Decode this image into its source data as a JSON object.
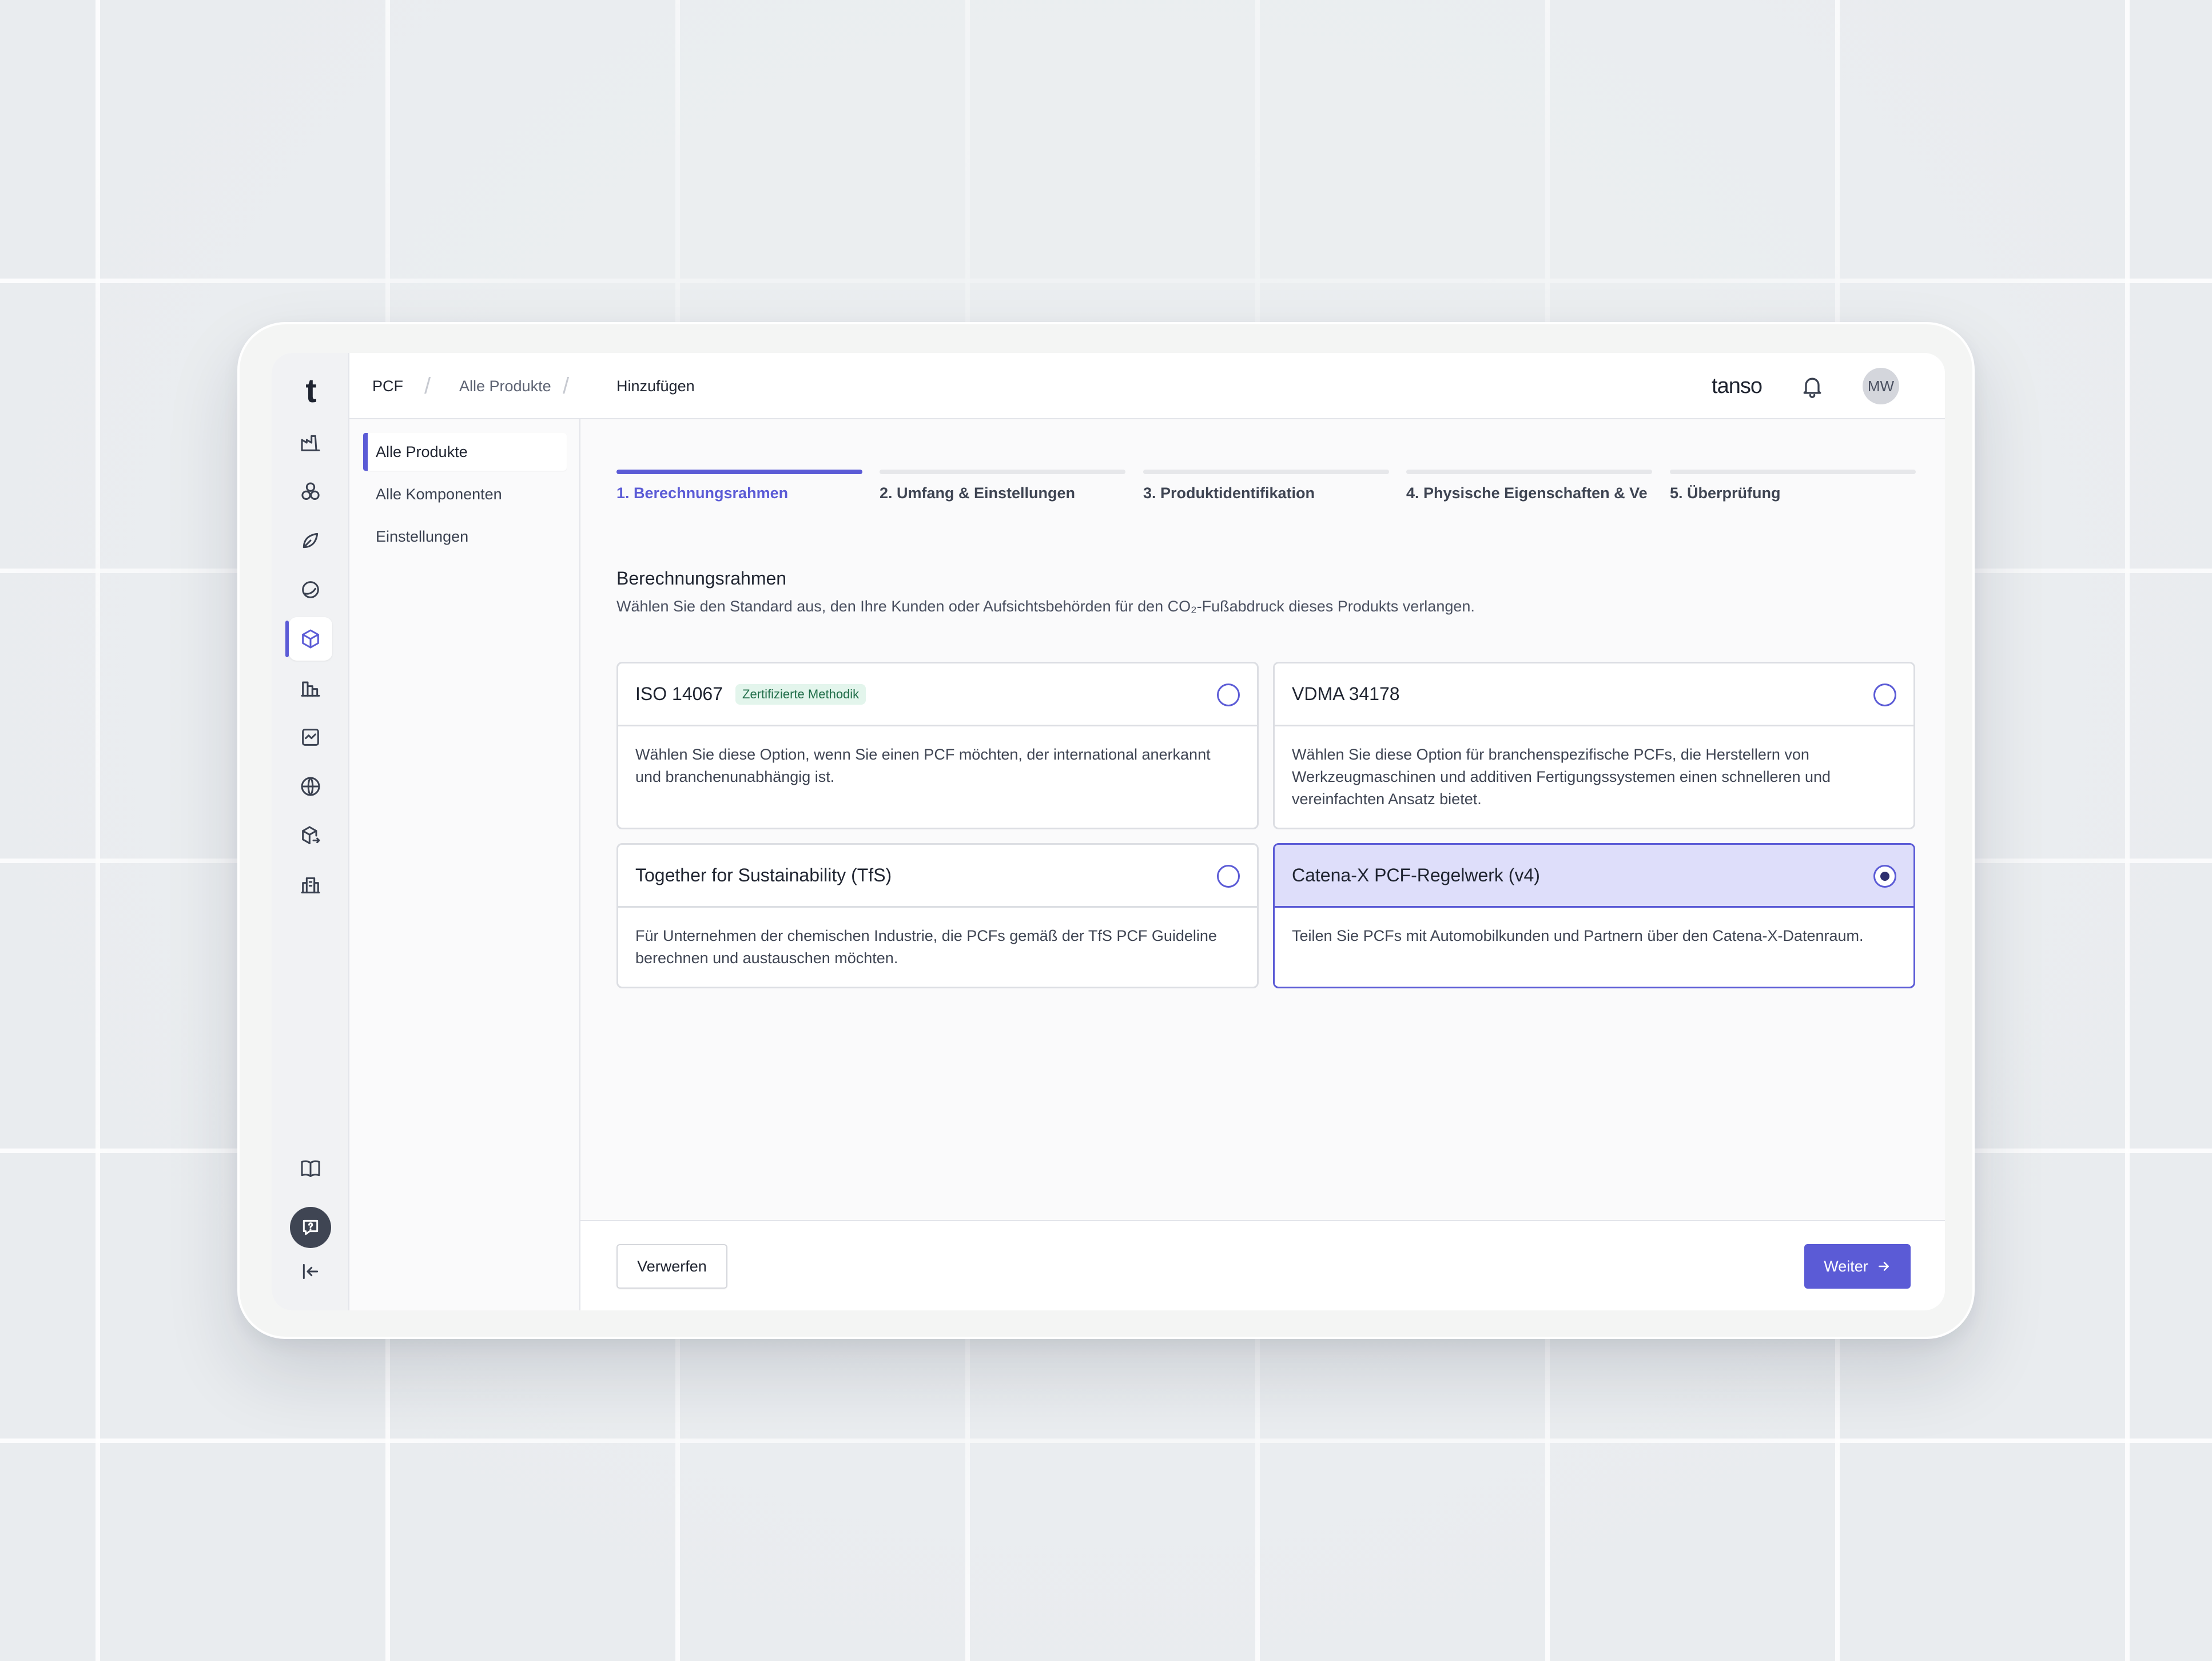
{
  "app": {
    "logo": "t",
    "brand": "tanso",
    "user_initials": "MW"
  },
  "breadcrumb": [
    "PCF",
    "Alle Produkte",
    "Hinzufügen"
  ],
  "rail": {
    "top_icons": [
      "factory-icon",
      "components-icon",
      "leaf-icon",
      "circular-icon",
      "product-box-icon",
      "bar-chart-icon",
      "report-icon",
      "globe-icon",
      "box-transfer-icon",
      "buildings-icon"
    ],
    "active_icon": "product-box-icon",
    "bottom_icons": [
      "book-icon",
      "help-chat-icon",
      "collapse-sidebar-icon"
    ]
  },
  "subnav": {
    "items": [
      "Alle Produkte",
      "Alle Komponenten",
      "Einstellungen"
    ],
    "active": "Alle Produkte"
  },
  "steps": [
    "1. Berechnungsrahmen",
    "2. Umfang & Einstellungen",
    "3. Produktidentifikation",
    "4. Physische Eigenschaften & Ve",
    "5. Überprüfung"
  ],
  "active_step": 1,
  "section": {
    "title": "Berechnungsrahmen",
    "description": "Wählen Sie den Standard aus, den Ihre Kunden oder Aufsichtsbehörden für den CO₂-Fußabdruck dieses Produkts verlangen."
  },
  "options": [
    {
      "title": "ISO 14067",
      "badge": "Zertifizierte Methodik",
      "description": "Wählen Sie diese Option, wenn Sie einen PCF möchten, der international anerkannt und branchenunabhängig ist.",
      "selected": false
    },
    {
      "title": "VDMA 34178",
      "description": "Wählen Sie diese Option für branchenspezifische PCFs, die Herstellern von Werkzeugmaschinen und additiven Fertigungssystemen einen schnelleren und vereinfachten Ansatz bietet.",
      "selected": false
    },
    {
      "title": "Together for Sustainability (TfS)",
      "description": "Für Unternehmen der chemischen Industrie, die PCFs gemäß der TfS PCF Guideline berechnen und austauschen möchten.",
      "selected": false
    },
    {
      "title": "Catena-X PCF-Regelwerk (v4)",
      "description": "Teilen Sie PCFs mit Automobilkunden und Partnern über den Catena-X-Datenraum.",
      "selected": true
    }
  ],
  "footer": {
    "discard_label": "Verwerfen",
    "next_label": "Weiter"
  },
  "colors": {
    "accent": "#5b5bd6",
    "selected_card_header": "#dedefa",
    "badge_bg": "#e3f5ec",
    "badge_text": "#216e4a"
  }
}
